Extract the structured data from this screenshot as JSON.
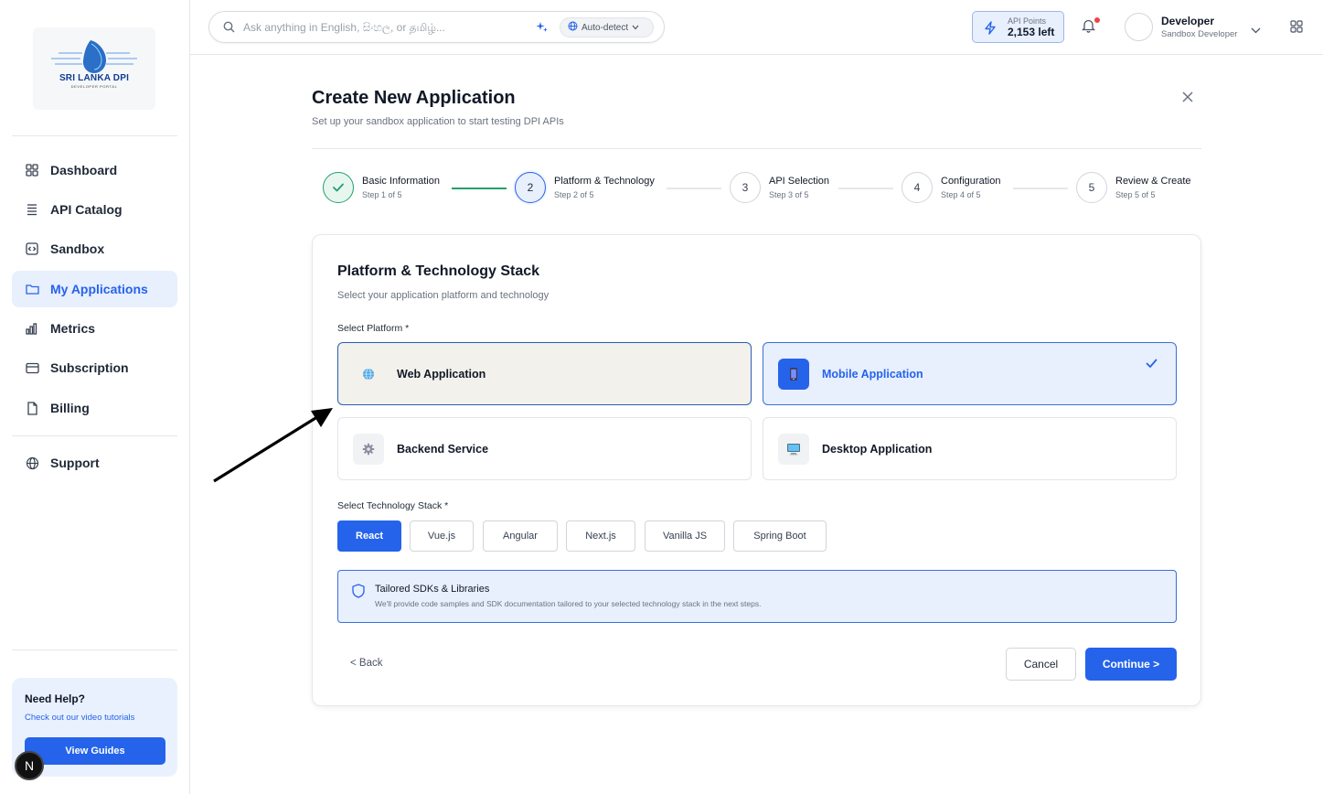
{
  "brand": {
    "logo_text": "SRI LANKA DPI",
    "logo_sub": "DEVELOPER PORTAL"
  },
  "sidebar": {
    "items": [
      {
        "label": "Dashboard",
        "icon": "grid-icon"
      },
      {
        "label": "API Catalog",
        "icon": "stack-icon"
      },
      {
        "label": "Sandbox",
        "icon": "code-icon"
      },
      {
        "label": "My Applications",
        "icon": "folder-icon",
        "active": true
      },
      {
        "label": "Metrics",
        "icon": "bar-chart-icon"
      },
      {
        "label": "Subscription",
        "icon": "credit-card-icon"
      },
      {
        "label": "Billing",
        "icon": "file-icon"
      },
      {
        "label": "Support",
        "icon": "globe-icon"
      }
    ],
    "help": {
      "title": "Need Help?",
      "subtitle": "Check out our video tutorials",
      "button": "View Guides"
    },
    "badge": "N"
  },
  "topbar": {
    "search_placeholder": "Ask anything in English, සිංහල, or தமிழ்...",
    "language": "Auto-detect",
    "points_label": "API Points",
    "points_value": "2,153 left",
    "user_name": "Developer",
    "user_role": "Sandbox Developer"
  },
  "page": {
    "title": "Create New Application",
    "subtitle": "Set up your sandbox application to start testing DPI APIs"
  },
  "steps": [
    {
      "label": "Basic Information",
      "meta": "Step 1 of 5",
      "num": "1",
      "state": "done"
    },
    {
      "label": "Platform & Technology",
      "meta": "Step 2 of 5",
      "num": "2",
      "state": "current"
    },
    {
      "label": "API Selection",
      "meta": "Step 3 of 5",
      "num": "3",
      "state": "pending"
    },
    {
      "label": "Configuration",
      "meta": "Step 4 of 5",
      "num": "4",
      "state": "pending"
    },
    {
      "label": "Review & Create",
      "meta": "Step 5 of 5",
      "num": "5",
      "state": "pending"
    }
  ],
  "card": {
    "title": "Platform & Technology Stack",
    "subtitle": "Select your application platform and technology",
    "platform_label": "Select Platform *",
    "platforms": [
      {
        "label": "Web Application",
        "icon": "globe-icon",
        "state": "hover"
      },
      {
        "label": "Mobile Application",
        "icon": "mobile-icon",
        "state": "selected"
      },
      {
        "label": "Backend Service",
        "icon": "gear-icon",
        "state": "default"
      },
      {
        "label": "Desktop Application",
        "icon": "desktop-icon",
        "state": "default"
      }
    ],
    "tech_label": "Select Technology Stack *",
    "tech": [
      {
        "label": "React",
        "active": true
      },
      {
        "label": "Vue.js"
      },
      {
        "label": "Angular"
      },
      {
        "label": "Next.js"
      },
      {
        "label": "Vanilla JS"
      },
      {
        "label": "Spring Boot"
      }
    ],
    "info_title": "Tailored SDKs & Libraries",
    "info_text": "We'll provide code samples and SDK documentation tailored to your selected technology stack in the next steps.",
    "back": "< Back",
    "cancel": "Cancel",
    "continue": "Continue >"
  },
  "colors": {
    "accent": "#2563eb",
    "success": "#22a06b",
    "selected_bg": "#e8effd"
  }
}
